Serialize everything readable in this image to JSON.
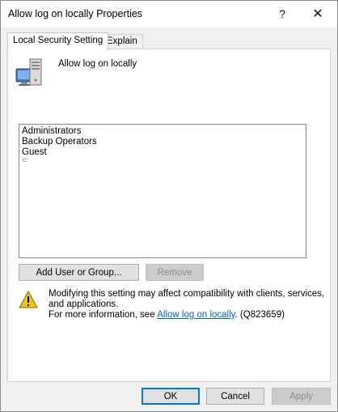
{
  "window": {
    "title": "Allow log on locally Properties",
    "help_glyph": "?",
    "close_glyph": "✕"
  },
  "tabs": [
    {
      "label": "Local Security Setting",
      "selected": true
    },
    {
      "label": "Explain",
      "selected": false
    }
  ],
  "policy": {
    "name": "Allow log on locally",
    "icon": "server-computer-icon"
  },
  "members": [
    "Administrators",
    "Backup Operators",
    "Guest",
    "S"
  ],
  "actions": {
    "add_label": "Add User or Group...",
    "remove_label": "Remove",
    "remove_enabled": false
  },
  "warning": {
    "icon": "warning-icon",
    "line1": "Modifying this setting may affect compatibility with clients, services,",
    "line2": "and applications.",
    "line3_prefix": "For more information, see ",
    "link_text": "Allow log on locally",
    "line3_suffix": ". (Q823659)"
  },
  "footer": {
    "ok_label": "OK",
    "cancel_label": "Cancel",
    "apply_label": "Apply",
    "apply_enabled": false
  },
  "colors": {
    "link": "#0066cc",
    "focus_border": "#0078d7",
    "warning_fill": "#f4c20d"
  }
}
